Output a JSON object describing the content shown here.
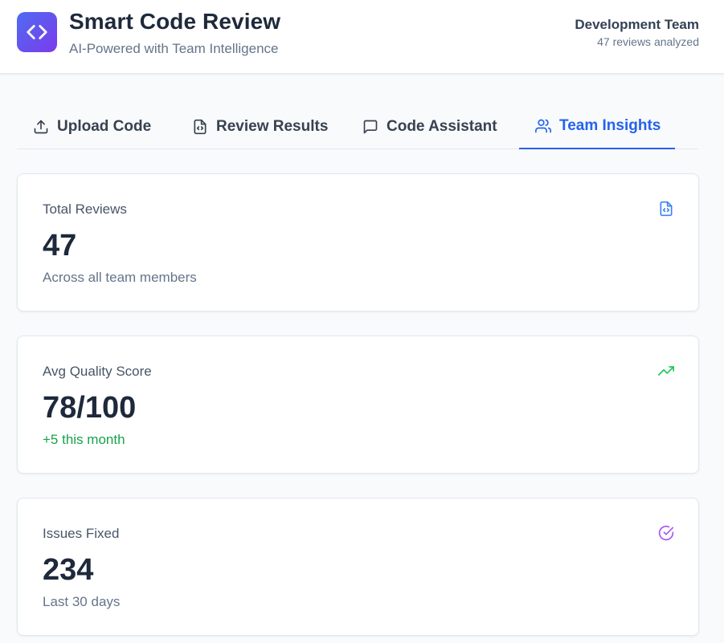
{
  "header": {
    "title": "Smart Code Review",
    "subtitle": "AI-Powered with Team Intelligence",
    "team_name": "Development Team",
    "team_meta": "47 reviews analyzed",
    "logo_icon": "code-brackets-icon"
  },
  "tabs": [
    {
      "label": "Upload Code",
      "icon": "upload-icon",
      "active": false
    },
    {
      "label": "Review Results",
      "icon": "file-code-icon",
      "active": false
    },
    {
      "label": "Code Assistant",
      "icon": "message-square-icon",
      "active": false
    },
    {
      "label": "Team Insights",
      "icon": "users-icon",
      "active": true
    }
  ],
  "cards": [
    {
      "label": "Total Reviews",
      "value": "47",
      "note": "Across all team members",
      "icon": "file-code-icon",
      "icon_color": "#3b82f6"
    },
    {
      "label": "Avg Quality Score",
      "value": "78/100",
      "note": "+5 this month",
      "icon": "trending-up-icon",
      "icon_color": "#22c55e"
    },
    {
      "label": "Issues Fixed",
      "value": "234",
      "note": "Last 30 days",
      "icon": "check-circle-icon",
      "icon_color": "#a855f7"
    }
  ],
  "colors": {
    "accent": "#2563eb",
    "logo_gradient_start": "#4f6cf0",
    "logo_gradient_end": "#7c3aed",
    "positive": "#16a34a"
  }
}
